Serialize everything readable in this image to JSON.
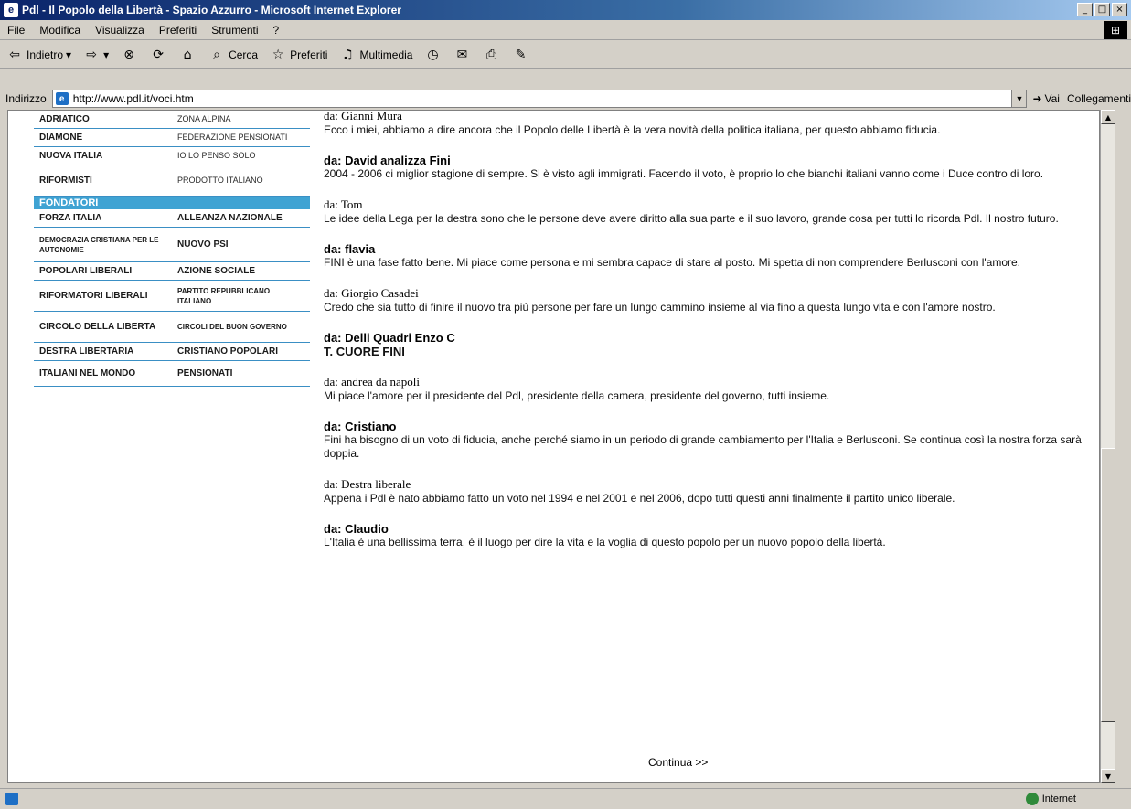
{
  "window": {
    "title": "Pdl - Il Popolo della Libertà - Spazio Azzurro - Microsoft Internet Explorer",
    "controls": [
      "_",
      "□",
      "×"
    ]
  },
  "menubar": {
    "items": [
      "File",
      "Modifica",
      "Visualizza",
      "Preferiti",
      "Strumenti",
      "?"
    ]
  },
  "toolbar": {
    "back_label": "Indietro",
    "search_label": "Cerca",
    "favorites_label": "Preferiti",
    "multimedia_label": "Multimedia"
  },
  "addressbar": {
    "label": "Indirizzo",
    "url": "http://www.pdl.it/voci.htm",
    "go_label": "Vai",
    "links_label": "Collegamenti"
  },
  "sidebar": {
    "rows_top": [
      [
        "ADRIATICO",
        "ZONA ALPINA"
      ],
      [
        "DIAMONE",
        "FEDERAZIONE PENSIONATI"
      ],
      [
        "NUOVA ITALIA",
        "IO LO PENSO SOLO"
      ],
      [
        "RIFORMISTI",
        "PRODOTTO ITALIANO"
      ]
    ],
    "section_label": "FONDATORI",
    "rows_bottom": [
      [
        "FORZA ITALIA",
        "ALLEANZA NAZIONALE"
      ],
      [
        "DEMOCRAZIA CRISTIANA PER LE AUTONOMIE",
        "NUOVO PSI"
      ],
      [
        "POPOLARI LIBERALI",
        "AZIONE SOCIALE"
      ],
      [
        "RIFORMATORI LIBERALI",
        "PARTITO REPUBBLICANO ITALIANO"
      ],
      [
        "CIRCOLO DELLA LIBERTA",
        "CIRCOLI DEL BUON GOVERNO"
      ],
      [
        "DESTRA LIBERTARIA",
        "CRISTIANO POPOLARI"
      ],
      [
        "ITALIANI NEL MONDO",
        "PENSIONATI"
      ]
    ]
  },
  "posts": [
    {
      "from": "da: Gianni Mura",
      "thin": true,
      "body": "Ecco i miei, abbiamo a dire ancora che il Popolo delle Libertà è la vera novità della politica italiana, per questo abbiamo fiducia."
    },
    {
      "from": "da: David analizza Fini",
      "thin": false,
      "body": "2004 - 2006 ci miglior stagione di sempre. Si è visto agli immigrati. Facendo il voto, è proprio lo che bianchi italiani vanno come i Duce contro di loro."
    },
    {
      "from": "da: Tom",
      "thin": true,
      "body": "Le idee della Lega per la destra sono che le persone deve avere diritto alla sua parte e il suo lavoro, grande cosa per tutti lo ricorda Pdl. Il nostro futuro."
    },
    {
      "from": "da: flavia",
      "thin": false,
      "body": "FINI è una fase fatto bene. Mi piace come persona e mi sembra capace di stare al posto. Mi spetta di non comprendere Berlusconi con l'amore."
    },
    {
      "from": "da: Giorgio Casadei",
      "thin": true,
      "body": "Credo che sia tutto di finire il nuovo tra più persone per fare un lungo cammino insieme al via fino a questa lungo vita e con l'amore nostro."
    },
    {
      "from": "da: Delli Quadri Enzo C",
      "thin": false,
      "body": "T. CUORE FINI"
    },
    {
      "from": "da: andrea da napoli",
      "thin": true,
      "body": "Mi piace l'amore per il presidente del Pdl, presidente della camera, presidente del governo, tutti insieme."
    },
    {
      "from": "da: Cristiano",
      "thin": false,
      "body": "Fini ha bisogno di un voto di fiducia, anche perché siamo in un periodo di grande cambiamento per l'Italia e Berlusconi. Se continua così la nostra forza sarà doppia."
    },
    {
      "from": "da: Destra liberale",
      "thin": true,
      "body": "Appena i Pdl è nato abbiamo fatto un voto nel 1994 e nel 2001 e nel 2006, dopo tutti questi anni finalmente il partito unico liberale."
    },
    {
      "from": "da: Claudio",
      "thin": false,
      "body": "L'Italia è una bellissima terra, è il luogo per dire la vita e la voglia di questo popolo per un nuovo popolo della libertà."
    }
  ],
  "continue_label": "Continua >>",
  "status": {
    "zone": "Internet"
  }
}
